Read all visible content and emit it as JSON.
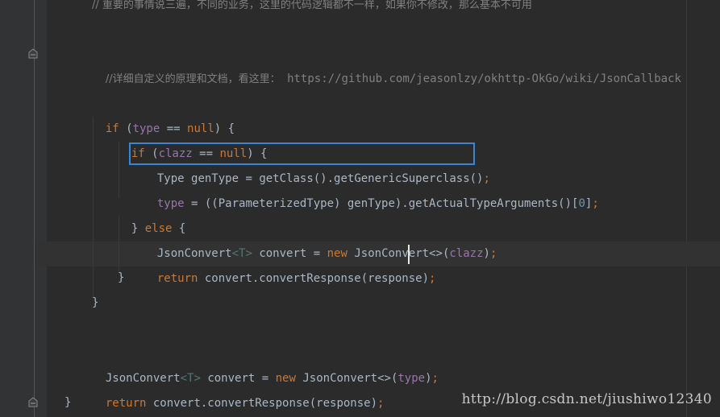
{
  "editor": {
    "line_top_comment": "// 重要的事情说三遍，不同的业务，这里的代码逻辑都不一样，如果你不修改，那么基本不可用",
    "line_doc_comment_cn": "//详细自定义的原理和文档，看这里：",
    "line_doc_comment_url": "https://github.com/jeasonlzy/okhttp-OkGo/wiki/JsonCallback",
    "tokens": {
      "if": "if",
      "type": "type",
      "eqeq": "==",
      "null": "null",
      "clazz": "clazz",
      "Type": "Type",
      "genType": "genType",
      "getClass_expr": "= getClass().getGenericSuperclass()",
      "assign_parameterized": "= ((ParameterizedType) genType).getActualTypeArguments()",
      "index_open": "[",
      "zero": "0",
      "index_close": "]",
      "semi": ";",
      "else": "else",
      "JsonConvert": "JsonConvert",
      "T": "T",
      "lt": "<",
      "gt": ">",
      "diamond": "<>",
      "convert_eq": "convert =",
      "new": "new",
      "return": "return",
      "convertResponse": "convert.convertResponse(response)",
      "open_paren": "(",
      "close_paren": ")",
      "open_brace": "{",
      "close_brace": "}",
      "open_brace_sp": ") {",
      "close_else": "} ",
      "space_paren": " ("
    }
  },
  "watermark": "http://blog.csdn.net/jiushiwo12340",
  "colors": {
    "background": "#2b2b2b",
    "keyword": "#cc7832",
    "field": "#9876aa",
    "comment": "#808080",
    "number": "#6897bb",
    "text": "#a9b7c6",
    "highlight_box": "#3a86d4"
  }
}
